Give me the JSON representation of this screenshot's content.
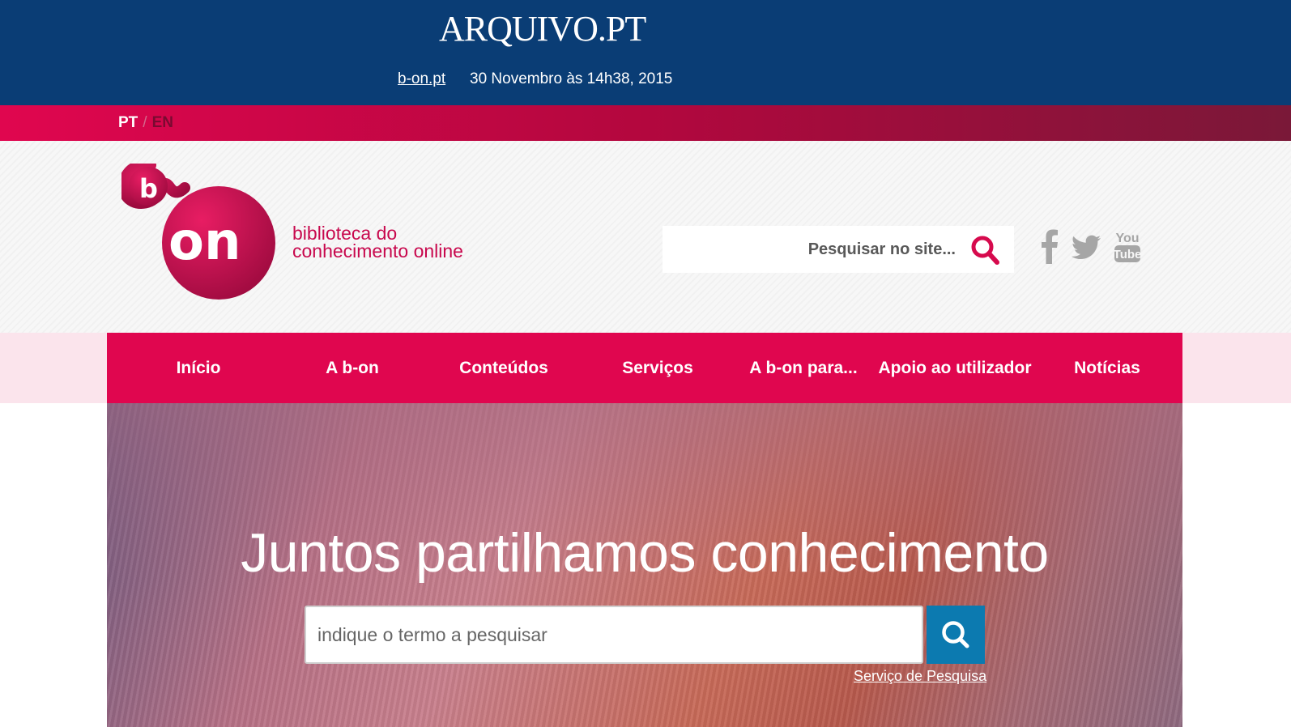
{
  "archive_bar": {
    "logo": "ARQUIVO.PT",
    "site_link": "b-on.pt",
    "capture_date": "30 Novembro às 14h38, 2015",
    "color": "#0a3d75"
  },
  "language": {
    "current": "PT",
    "separator": "/",
    "other": "EN"
  },
  "header": {
    "logo_text": "b-on",
    "tagline_line1": "biblioteca do",
    "tagline_line2": "conhecimento online",
    "search_placeholder": "Pesquisar no site...",
    "social_icons": [
      "facebook-icon",
      "twitter-icon",
      "youtube-icon"
    ],
    "youtube_text_top": "You",
    "youtube_text_bottom": "Tube",
    "brand_color": "#e0064f"
  },
  "nav": {
    "items": [
      {
        "label": "Início"
      },
      {
        "label": "A b-on"
      },
      {
        "label": "Conteúdos"
      },
      {
        "label": "Serviços"
      },
      {
        "label": "A b-on para..."
      },
      {
        "label": "Apoio ao utilizador"
      },
      {
        "label": "Notícias"
      }
    ]
  },
  "hero": {
    "title": "Juntos partilhamos conhecimento",
    "search_placeholder": "indique o termo a pesquisar",
    "search_button_color": "#0c7ab0",
    "link": "Serviço de Pesquisa"
  }
}
